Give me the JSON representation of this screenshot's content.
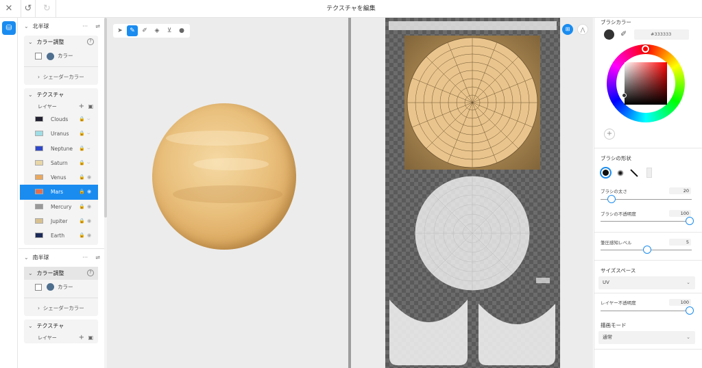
{
  "header": {
    "title": "テクスチャを編集"
  },
  "left_panel": {
    "sections": [
      {
        "name": "北半球",
        "color_adjust": {
          "label": "カラー調整",
          "color_label": "カラー"
        },
        "shader_color_label": "シェーダーカラー",
        "texture": {
          "label": "テクスチャ",
          "layer_header": "レイヤー",
          "layers": [
            "Clouds",
            "Uranus",
            "Neptune",
            "Saturn",
            "Venus",
            "Mars",
            "Mercury",
            "Jupiter",
            "Earth"
          ],
          "selected": "Mars"
        }
      },
      {
        "name": "南半球",
        "color_adjust": {
          "label": "カラー調整",
          "color_label": "カラー"
        },
        "shader_color_label": "シェーダーカラー",
        "texture": {
          "label": "テクスチャ",
          "layer_header": "レイヤー"
        }
      }
    ]
  },
  "right_panel": {
    "brush_color": {
      "label": "ブラシカラー",
      "hex": "#333333"
    },
    "brush_shape": {
      "label": "ブラシの形状"
    },
    "brush_size": {
      "label": "ブラシの太さ",
      "value": "20"
    },
    "brush_opacity": {
      "label": "ブラシの不透明度",
      "value": "100"
    },
    "pressure": {
      "label": "筆圧感知レベル",
      "value": "5"
    },
    "size_space": {
      "label": "サイズスペース",
      "selected": "UV"
    },
    "layer_opacity": {
      "label": "レイヤー不透明度",
      "value": "100"
    },
    "draw_mode": {
      "label": "描画モード",
      "selected": "通常"
    }
  },
  "colors": {
    "accent": "#1a8cf0",
    "color_swatch": "#4f6f8f"
  }
}
